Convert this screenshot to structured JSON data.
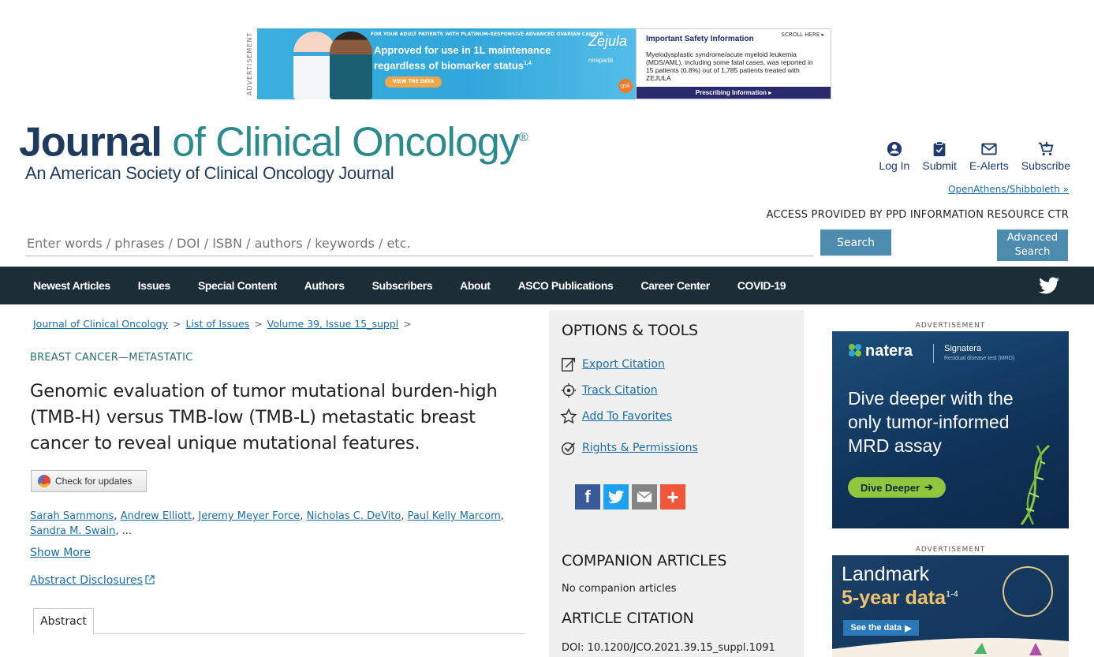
{
  "top_ad": {
    "vertical_label": "ADVERTISEMENT",
    "small_line": "FOR YOUR ADULT PATIENTS WITH PLATINUM-RESPONSIVE ADVANCED OVARIAN CANCER",
    "headline_1": "Approved for use in 1L maintenance",
    "headline_2": "regardless of biomarker status",
    "headline_sup": "1,4",
    "cta": "VIEW THE DATA",
    "brand": "Zejula",
    "brand_sub": "niraparib",
    "company": "gsk",
    "isi_title": "Important Safety Information",
    "isi_scroll": "SCROLL HERE",
    "isi_body": "Myelodysplastic syndrome/acute myeloid leukemia (MDS/AML), including some fatal cases, was reported in 15 patients (0.8%) out of 1,785 patients treated with ZEJULA",
    "isi_footer": "Prescribing Information"
  },
  "logo": {
    "journal": "Journal",
    "rest": " of Clinical Oncology",
    "reg": "®",
    "subtitle": "An American Society of Clinical Oncology Journal"
  },
  "header_actions": [
    {
      "label": "Log In",
      "icon": "user-icon"
    },
    {
      "label": "Submit",
      "icon": "clipboard-check-icon"
    },
    {
      "label": "E-Alerts",
      "icon": "envelope-icon"
    },
    {
      "label": "Subscribe",
      "icon": "cart-icon"
    }
  ],
  "openathens": "OpenAthens/Shibboleth »",
  "access": "ACCESS PROVIDED BY PPD INFORMATION RESOURCE CTR",
  "search": {
    "placeholder": "Enter words / phrases / DOI / ISBN / authors / keywords / etc.",
    "button": "Search",
    "advanced_1": "Advanced",
    "advanced_2": "Search"
  },
  "nav": {
    "items": [
      "Newest Articles",
      "Issues",
      "Special Content",
      "Authors",
      "Subscribers",
      "About",
      "ASCO Publications",
      "Career Center",
      "COVID-19"
    ],
    "social_icon": "twitter-icon"
  },
  "breadcrumb": [
    "Journal of Clinical Oncology",
    "List of Issues",
    "Volume 39, Issue 15_suppl"
  ],
  "breadcrumb_sep": ">",
  "article": {
    "category": "BREAST CANCER—METASTATIC",
    "title": "Genomic evaluation of tumor mutational burden-high (TMB-H) versus TMB-low (TMB-L) metastatic breast cancer to reveal unique mutational features.",
    "check_updates": "Check for updates",
    "authors": [
      "Sarah Sammons",
      "Andrew Elliott",
      "Jeremy Meyer Force",
      "Nicholas C. DeVito",
      "Paul Kelly Marcom",
      "Sandra M. Swain"
    ],
    "authors_more": "...",
    "show_more": "Show More",
    "abstract_disclosures": "Abstract Disclosures",
    "tab_abstract": "Abstract"
  },
  "options": {
    "title": "OPTIONS & TOOLS",
    "items": [
      {
        "label": "Export Citation",
        "icon": "export-icon"
      },
      {
        "label": "Track Citation",
        "icon": "target-icon"
      },
      {
        "label": "Add To Favorites",
        "icon": "star-icon"
      },
      {
        "label": "Rights & Permissions",
        "icon": "check-circle-icon"
      }
    ],
    "share": [
      {
        "icon": "facebook-icon",
        "color": "#3b5998",
        "glyph": "f"
      },
      {
        "icon": "twitter-icon",
        "color": "#1da1f2",
        "glyph": ""
      },
      {
        "icon": "email-icon",
        "color": "#848484",
        "glyph": ""
      },
      {
        "icon": "plus-icon",
        "color": "#f0573a",
        "glyph": "+"
      }
    ],
    "companion_title": "COMPANION ARTICLES",
    "companion_none": "No companion articles",
    "citation_title": "ARTICLE CITATION",
    "doi": "DOI: 10.1200/JCO.2021.39.15_suppl.1091"
  },
  "right_ads": {
    "label": "ADVERTISEMENT",
    "natera": {
      "logo": "natera",
      "product": "Signatera",
      "product_sub": "Residual disease test (MRD)",
      "headline": "Dive deeper with the only tumor-informed MRD assay",
      "cta": "Dive Deeper"
    },
    "landmark": {
      "line1": "Landmark",
      "line2": "5-year data",
      "sup": "1-4",
      "cta": "See the data"
    }
  },
  "colors": {
    "nav_bg": "#1d2d36",
    "button": "#4d8baf",
    "link": "#1a6ea8",
    "options_bg": "#f0f0f0",
    "logo_dark": "#1f3a5f",
    "logo_teal": "#2a8a8c"
  }
}
